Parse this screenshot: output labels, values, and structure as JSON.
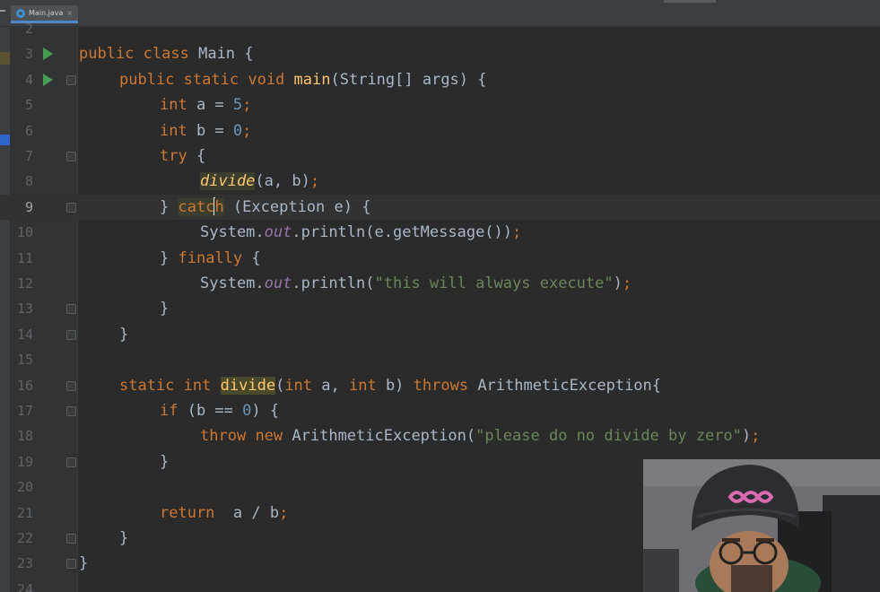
{
  "editor": {
    "tab": {
      "label": "Main.java",
      "close": "×"
    },
    "lines": [
      {
        "num": "2"
      },
      {
        "num": "3",
        "run": true,
        "indent": 0,
        "tokens": [
          [
            "kw",
            "public"
          ],
          [
            "p",
            " "
          ],
          [
            "kw",
            "class"
          ],
          [
            "p",
            " Main {"
          ]
        ]
      },
      {
        "num": "4",
        "run": true,
        "fold": true,
        "indent": 1,
        "tokens": [
          [
            "kw",
            "public"
          ],
          [
            "p",
            " "
          ],
          [
            "kw",
            "static"
          ],
          [
            "p",
            " "
          ],
          [
            "kw",
            "void"
          ],
          [
            "p",
            " "
          ],
          [
            "fn",
            "main"
          ],
          [
            "p",
            "(String[] args) {"
          ]
        ]
      },
      {
        "num": "5",
        "indent": 2,
        "tokens": [
          [
            "kw",
            "int"
          ],
          [
            "p",
            " a = "
          ],
          [
            "num",
            "5"
          ],
          [
            "kw",
            ";"
          ]
        ]
      },
      {
        "num": "6",
        "indent": 2,
        "tokens": [
          [
            "kw",
            "int"
          ],
          [
            "p",
            " b = "
          ],
          [
            "num",
            "0"
          ],
          [
            "kw",
            ";"
          ]
        ]
      },
      {
        "num": "7",
        "fold": true,
        "indent": 2,
        "tokens": [
          [
            "kw",
            "try"
          ],
          [
            "p",
            " {"
          ]
        ]
      },
      {
        "num": "8",
        "indent": 3,
        "tokens": [
          [
            "fn it hl",
            "divide"
          ],
          [
            "p",
            "(a, b)"
          ],
          [
            "kw",
            ";"
          ]
        ]
      },
      {
        "num": "9",
        "current": true,
        "fold": true,
        "indent": 2,
        "tokens": [
          [
            "p",
            "} "
          ],
          [
            "kw hl",
            "catc"
          ],
          [
            "caret",
            ""
          ],
          [
            "kw hl",
            "h"
          ],
          [
            "p",
            " (Exception e) {"
          ]
        ]
      },
      {
        "num": "10",
        "indent": 3,
        "tokens": [
          [
            "p",
            "System."
          ],
          [
            "stat",
            "out"
          ],
          [
            "p",
            ".println(e.getMessage())"
          ],
          [
            "kw",
            ";"
          ]
        ]
      },
      {
        "num": "11",
        "indent": 2,
        "tokens": [
          [
            "p",
            "} "
          ],
          [
            "kw",
            "finally"
          ],
          [
            "p",
            " {"
          ]
        ]
      },
      {
        "num": "12",
        "indent": 3,
        "tokens": [
          [
            "p",
            "System."
          ],
          [
            "stat",
            "out"
          ],
          [
            "p",
            ".println("
          ],
          [
            "str",
            "\"this will always execute\""
          ],
          [
            "p",
            ")"
          ],
          [
            "kw",
            ";"
          ]
        ]
      },
      {
        "num": "13",
        "fold": true,
        "indent": 2,
        "tokens": [
          [
            "p",
            "}"
          ]
        ]
      },
      {
        "num": "14",
        "fold": true,
        "indent": 1,
        "tokens": [
          [
            "p",
            "}"
          ]
        ]
      },
      {
        "num": "15"
      },
      {
        "num": "16",
        "fold": true,
        "indent": 1,
        "tokens": [
          [
            "kw",
            "static"
          ],
          [
            "p",
            " "
          ],
          [
            "kw",
            "int"
          ],
          [
            "p",
            " "
          ],
          [
            "fn hl-strong",
            "divide"
          ],
          [
            "p",
            "("
          ],
          [
            "kw",
            "int"
          ],
          [
            "p",
            " a, "
          ],
          [
            "kw",
            "int"
          ],
          [
            "p",
            " b) "
          ],
          [
            "kw",
            "throws"
          ],
          [
            "p",
            " ArithmeticException{"
          ]
        ]
      },
      {
        "num": "17",
        "fold": true,
        "indent": 2,
        "tokens": [
          [
            "kw",
            "if"
          ],
          [
            "p",
            " (b == "
          ],
          [
            "num",
            "0"
          ],
          [
            "p",
            ") {"
          ]
        ]
      },
      {
        "num": "18",
        "indent": 3,
        "tokens": [
          [
            "kw",
            "throw"
          ],
          [
            "p",
            " "
          ],
          [
            "kw",
            "new"
          ],
          [
            "p",
            " ArithmeticException("
          ],
          [
            "str",
            "\"please do no divide by zero\""
          ],
          [
            "p",
            ")"
          ],
          [
            "kw",
            ";"
          ]
        ]
      },
      {
        "num": "19",
        "fold": true,
        "indent": 2,
        "tokens": [
          [
            "p",
            "}"
          ]
        ]
      },
      {
        "num": "20"
      },
      {
        "num": "21",
        "indent": 2,
        "tokens": [
          [
            "kw",
            "return"
          ],
          [
            "p",
            "  a / b"
          ],
          [
            "kw",
            ";"
          ]
        ]
      },
      {
        "num": "22",
        "fold": true,
        "indent": 1,
        "tokens": [
          [
            "p",
            "}"
          ]
        ]
      },
      {
        "num": "23",
        "fold": true,
        "indent": 0,
        "tokens": [
          [
            "p",
            "}"
          ]
        ]
      },
      {
        "num": "24"
      }
    ]
  },
  "colors": {
    "background": "#2b2b2b",
    "keyword": "#cc7832",
    "number": "#6897bb",
    "string": "#6a8759",
    "method": "#ffc66d",
    "static_field": "#9876aa",
    "run_icon": "#499c54"
  },
  "webcam": {
    "icon": "webcam-person-overlay"
  }
}
